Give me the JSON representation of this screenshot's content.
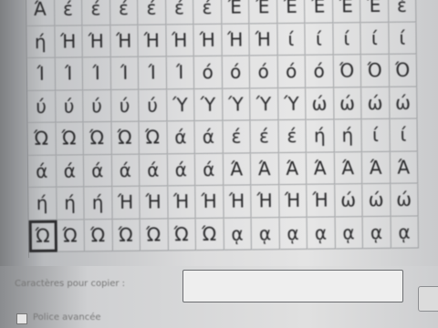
{
  "character_grid": {
    "rows": [
      [
        "Ά",
        "έ",
        "έ",
        "έ",
        "έ",
        "έ",
        "έ",
        "Έ",
        "Έ",
        "Έ",
        "Έ",
        "Έ",
        "Έ",
        "ἑ"
      ],
      [
        "ή",
        "Ή",
        "Ή",
        "Ή",
        "Ή",
        "Ή",
        "Ή",
        "Ή",
        "Ή",
        "ί",
        "ί",
        "ί",
        "ί",
        "ί"
      ],
      [
        "Ί",
        "Ί",
        "Ί",
        "Ί",
        "Ί",
        "Ί",
        "ό",
        "ό",
        "ό",
        "ό",
        "ό",
        "Ό",
        "Ό",
        "Ό"
      ],
      [
        "ύ",
        "ύ",
        "ύ",
        "ύ",
        "ύ",
        "Ύ",
        "Ύ",
        "Ύ",
        "Ύ",
        "Ύ",
        "ώ",
        "ώ",
        "ώ",
        "ώ"
      ],
      [
        "Ώ",
        "Ώ",
        "Ώ",
        "Ώ",
        "Ώ",
        "ά",
        "ά",
        "έ",
        "έ",
        "έ",
        "ή",
        "ή",
        "ί",
        "ί"
      ],
      [
        "ά",
        "ά",
        "ά",
        "ά",
        "ά",
        "ά",
        "ά",
        "Ά",
        "Ά",
        "Ά",
        "Ά",
        "Ά",
        "Ά",
        "Ά"
      ],
      [
        "ή",
        "ή",
        "ή",
        "Ή",
        "Ή",
        "Ή",
        "Ή",
        "Ή",
        "Ή",
        "Ή",
        "Ή",
        "ώ",
        "ώ",
        "ώ"
      ],
      [
        "Ώ",
        "Ώ",
        "Ώ",
        "Ώ",
        "Ώ",
        "Ώ",
        "Ώ",
        "ᾳ",
        "ᾳ",
        "ᾳ",
        "ᾳ",
        "ᾳ",
        "ᾳ",
        "ᾳ"
      ]
    ],
    "selected": {
      "row": 7,
      "col": 0
    }
  },
  "form": {
    "label": "Caractères pour copier :",
    "checkbox_label": "Police avancée"
  }
}
